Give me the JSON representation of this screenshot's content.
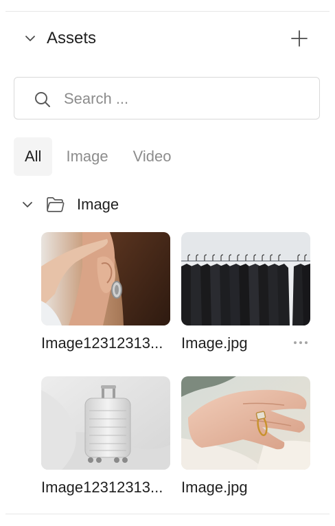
{
  "panel": {
    "title": "Assets"
  },
  "search": {
    "placeholder": "Search ..."
  },
  "tabs": [
    {
      "label": "All",
      "active": true
    },
    {
      "label": "Image",
      "active": false
    },
    {
      "label": "Video",
      "active": false
    }
  ],
  "folder": {
    "label": "Image"
  },
  "assets": [
    {
      "name": "Image12312313...",
      "icon": "earring-photo"
    },
    {
      "name": "Image.jpg",
      "icon": "clothes-rack-photo"
    },
    {
      "name": "Image12312313...",
      "icon": "suitcase-photo"
    },
    {
      "name": "Image.jpg",
      "icon": "ring-hand-photo"
    }
  ],
  "colors": {
    "text": "#1f1f1f",
    "muted": "#8c8c8c",
    "border": "#d9d9d9",
    "active_tab_bg": "#f4f4f4"
  }
}
